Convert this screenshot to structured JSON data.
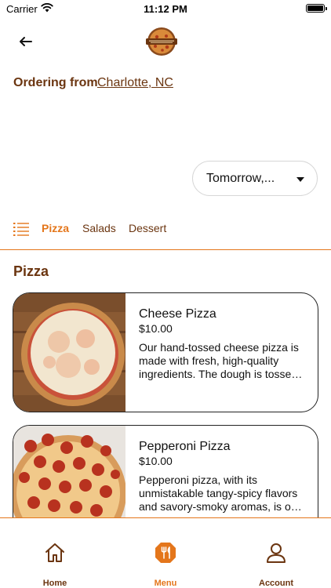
{
  "status_bar": {
    "carrier": "Carrier",
    "time": "11:12 PM",
    "icons": [
      "wifi-icon",
      "battery-icon"
    ]
  },
  "header": {
    "back_icon": "arrow-left-icon",
    "logo": "restaurant-logo"
  },
  "ordering": {
    "label": "Ordering from",
    "location": "Charlotte, NC"
  },
  "date_select": {
    "value": "Tomorrow,...",
    "icon": "caret-down-icon"
  },
  "categories": {
    "icon": "list-icon",
    "items": [
      {
        "label": "Pizza",
        "active": true
      },
      {
        "label": "Salads",
        "active": false
      },
      {
        "label": "Dessert",
        "active": false
      }
    ]
  },
  "section": {
    "title": "Pizza"
  },
  "menu_items": [
    {
      "name": "Cheese Pizza",
      "price": "$10.00",
      "description": "Our hand-tossed cheese pizza is made with fresh, high-quality ingredients. The dough is tossed by hand daily."
    },
    {
      "name": "Pepperoni Pizza",
      "price": "$10.00",
      "description": "Pepperoni pizza, with its unmistakable tangy-spicy flavors and savory-smoky aromas, is one of our favorites."
    }
  ],
  "bottom_nav": {
    "items": [
      {
        "label": "Home",
        "icon": "home-icon",
        "active": false
      },
      {
        "label": "Menu",
        "icon": "menu-icon",
        "active": true
      },
      {
        "label": "Account",
        "icon": "account-icon",
        "active": false
      }
    ]
  },
  "colors": {
    "brand_brown": "#6b3510",
    "accent_orange": "#e4761b",
    "text": "#111111"
  }
}
